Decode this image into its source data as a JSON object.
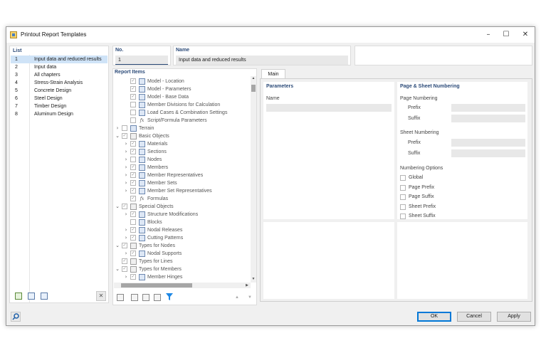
{
  "window": {
    "title": "Printout Report Templates",
    "min_glyph": "–",
    "max_glyph": "☐",
    "close_glyph": "✕"
  },
  "list": {
    "header": "List",
    "items": [
      {
        "no": "1",
        "name": "Input data and reduced results"
      },
      {
        "no": "2",
        "name": "Input data"
      },
      {
        "no": "3",
        "name": "All chapters"
      },
      {
        "no": "4",
        "name": "Stress-Strain Analysis"
      },
      {
        "no": "5",
        "name": "Concrete Design"
      },
      {
        "no": "6",
        "name": "Steel Design"
      },
      {
        "no": "7",
        "name": "Timber Design"
      },
      {
        "no": "8",
        "name": "Aluminum Design"
      }
    ],
    "selected_index": 0,
    "delete_glyph": "✕"
  },
  "fields": {
    "no_label": "No.",
    "no_value": "1",
    "name_label": "Name",
    "name_value": "Input data and reduced results"
  },
  "report_items": {
    "header": "Report Items",
    "rows": [
      {
        "level": 1,
        "expander": "",
        "label": "Model - Location",
        "icon": "model-location-icon",
        "checked": true
      },
      {
        "level": 1,
        "expander": "",
        "label": "Model - Parameters",
        "icon": "model-parameters-icon",
        "checked": true
      },
      {
        "level": 1,
        "expander": "",
        "label": "Model - Base Data",
        "icon": "model-base-data-icon",
        "checked": true
      },
      {
        "level": 1,
        "expander": "",
        "label": "Member Divisions for Calculation",
        "icon": "member-divisions-icon",
        "checked": false
      },
      {
        "level": 1,
        "expander": "",
        "label": "Load Cases & Combination Settings",
        "icon": "load-cases-icon",
        "checked": false
      },
      {
        "level": 1,
        "expander": "",
        "label": "Script/Formula Parameters",
        "icon": "formula-icon",
        "checked": false
      },
      {
        "level": 0,
        "expander": "›",
        "label": "Terrain",
        "icon": "terrain-icon",
        "checked": false
      },
      {
        "level": 0,
        "expander": "⌄",
        "label": "Basic Objects",
        "icon": "folder-icon",
        "checked": true
      },
      {
        "level": 1,
        "expander": "›",
        "label": "Materials",
        "icon": "materials-icon",
        "checked": true
      },
      {
        "level": 1,
        "expander": "›",
        "label": "Sections",
        "icon": "sections-icon",
        "checked": true
      },
      {
        "level": 1,
        "expander": "›",
        "label": "Nodes",
        "icon": "nodes-icon",
        "checked": false
      },
      {
        "level": 1,
        "expander": "›",
        "label": "Members",
        "icon": "members-icon",
        "checked": true
      },
      {
        "level": 1,
        "expander": "›",
        "label": "Member Representatives",
        "icon": "member-representatives-icon",
        "checked": true
      },
      {
        "level": 1,
        "expander": "›",
        "label": "Member Sets",
        "icon": "member-sets-icon",
        "checked": true
      },
      {
        "level": 1,
        "expander": "›",
        "label": "Member Set Representatives",
        "icon": "member-set-representatives-icon",
        "checked": true
      },
      {
        "level": 1,
        "expander": "",
        "label": "Formulas",
        "icon": "formula-icon",
        "checked": true
      },
      {
        "level": 0,
        "expander": "⌄",
        "label": "Special Objects",
        "icon": "folder-icon",
        "checked": true
      },
      {
        "level": 1,
        "expander": "›",
        "label": "Structure Modifications",
        "icon": "structure-modifications-icon",
        "checked": true
      },
      {
        "level": 1,
        "expander": "",
        "label": "Blocks",
        "icon": "blocks-icon",
        "checked": false
      },
      {
        "level": 1,
        "expander": "›",
        "label": "Nodal Releases",
        "icon": "nodal-releases-icon",
        "checked": true
      },
      {
        "level": 1,
        "expander": "›",
        "label": "Cutting Patterns",
        "icon": "cutting-patterns-icon",
        "checked": true
      },
      {
        "level": 0,
        "expander": "⌄",
        "label": "Types for Nodes",
        "icon": "folder-icon",
        "checked": true
      },
      {
        "level": 1,
        "expander": "›",
        "label": "Nodal Supports",
        "icon": "nodal-supports-icon",
        "checked": true
      },
      {
        "level": 0,
        "expander": "",
        "label": "Types for Lines",
        "icon": "folder-icon",
        "checked": true
      },
      {
        "level": 0,
        "expander": "⌄",
        "label": "Types for Members",
        "icon": "folder-icon",
        "checked": true
      },
      {
        "level": 1,
        "expander": "›",
        "label": "Member Hinges",
        "icon": "member-hinges-icon",
        "checked": true
      }
    ]
  },
  "tabs": [
    {
      "label": "Main"
    }
  ],
  "parameters": {
    "header": "Parameters",
    "name_label": "Name"
  },
  "numbering": {
    "header": "Page & Sheet Numbering",
    "page_numbering": "Page Numbering",
    "sheet_numbering": "Sheet Numbering",
    "prefix": "Prefix",
    "suffix": "Suffix",
    "options_header": "Numbering Options",
    "options": [
      "Global",
      "Page Prefix",
      "Page Suffix",
      "Sheet Prefix",
      "Sheet Suffix"
    ]
  },
  "buttons": {
    "ok": "OK",
    "cancel": "Cancel",
    "apply": "Apply"
  },
  "colors": {
    "accent": "#2b4a78",
    "selection": "#cfe3f7",
    "filter_icon": "#1e88e5"
  }
}
